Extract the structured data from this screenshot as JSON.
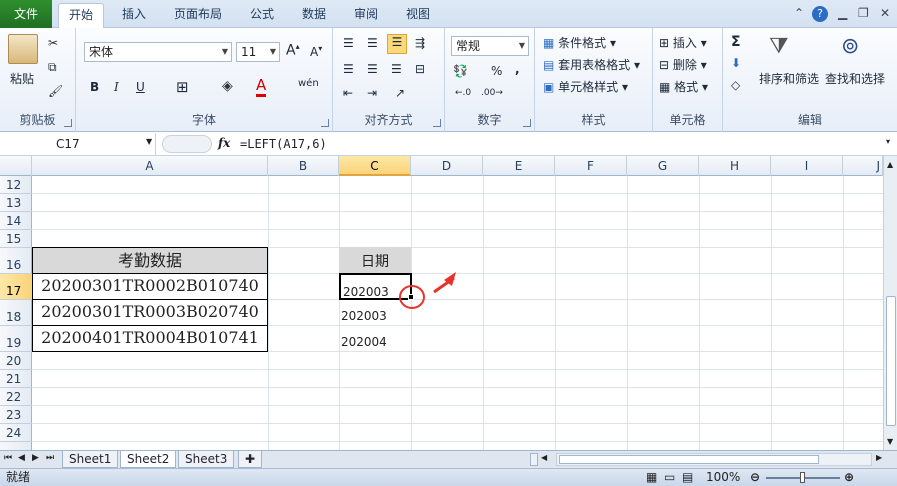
{
  "tabs": {
    "file": "文件",
    "home": "开始",
    "insert": "插入",
    "page_layout": "页面布局",
    "formulas": "公式",
    "data": "数据",
    "review": "审阅",
    "view": "视图"
  },
  "clipboard": {
    "paste": "粘贴",
    "label": "剪贴板"
  },
  "font": {
    "name": "宋体",
    "size": "11",
    "label": "字体",
    "bold": "B",
    "italic": "I",
    "underline": "U"
  },
  "alignment": {
    "label": "对齐方式"
  },
  "number": {
    "format": "常规",
    "label": "数字",
    "percent": "%",
    "comma": ","
  },
  "styles": {
    "conditional": "条件格式",
    "table": "套用表格格式",
    "cell_styles": "单元格样式",
    "label": "样式"
  },
  "cells": {
    "insert": "插入",
    "delete": "删除",
    "format": "格式",
    "label": "单元格"
  },
  "editing": {
    "sum": "Σ",
    "sort": "排序和筛选",
    "find": "查找和选择",
    "label": "编辑"
  },
  "formula_bar": {
    "namebox": "C17",
    "fx": "fx",
    "formula": "=LEFT(A17,6)"
  },
  "columns": [
    "A",
    "B",
    "C",
    "D",
    "E",
    "F",
    "G",
    "H",
    "I",
    "J"
  ],
  "rows": [
    "12",
    "13",
    "14",
    "15",
    "16",
    "17",
    "18",
    "19",
    "20",
    "21",
    "22",
    "23",
    "24"
  ],
  "cells_data": {
    "a16": "考勤数据",
    "a17": "20200301TR0002B010740",
    "a18": "20200301TR0003B020740",
    "a19": "20200401TR0004B010741",
    "c16": "日期",
    "c17": "202003",
    "c18": "202003",
    "c19": "202004"
  },
  "sheets": [
    "Sheet1",
    "Sheet2",
    "Sheet3"
  ],
  "status": {
    "ready": "就绪",
    "zoom": "100%"
  },
  "colors": {
    "file_tab": "#1f6f22",
    "selection": "#f9d37a",
    "annotation": "#e8332a"
  }
}
